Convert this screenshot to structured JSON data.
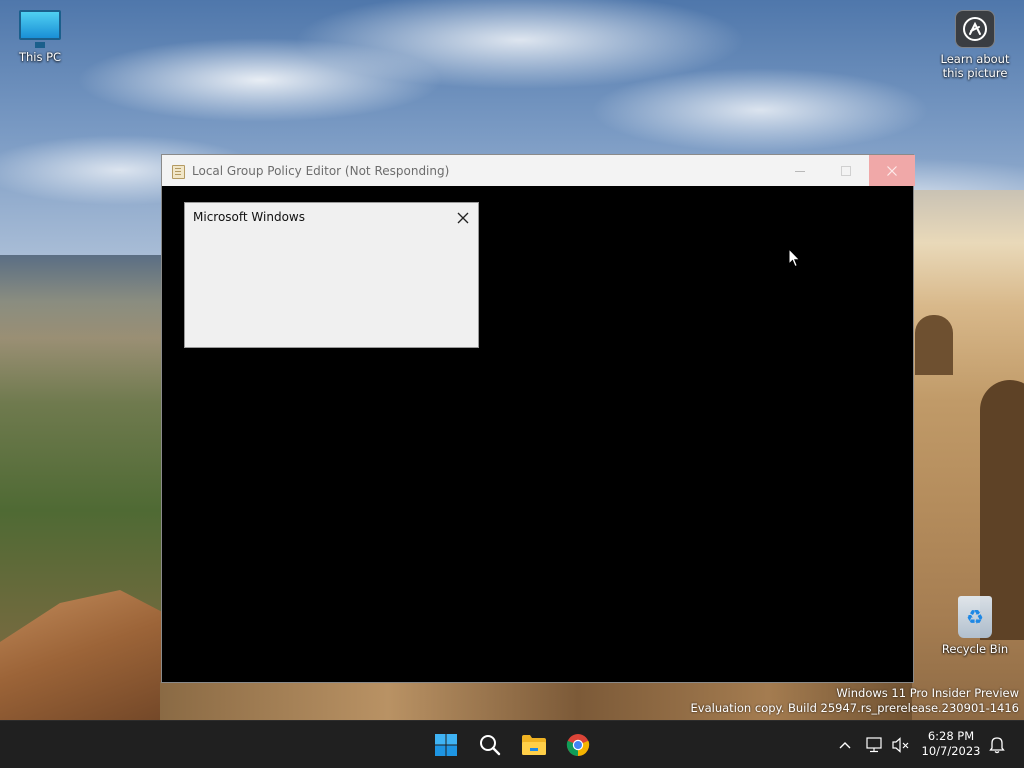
{
  "desktop": {
    "icons": {
      "this_pc": "This PC",
      "learn_line1": "Learn about",
      "learn_line2": "this picture",
      "recycle_bin": "Recycle Bin"
    }
  },
  "window": {
    "title": "Local Group Policy Editor (Not Responding)",
    "buttons": [
      "minimize-icon",
      "maximize-icon",
      "close-icon"
    ]
  },
  "dialog": {
    "title": "Microsoft Windows",
    "close_icon": "close-icon"
  },
  "watermark": {
    "line1": "Windows 11 Pro Insider Preview",
    "line2": "Evaluation copy. Build 25947.rs_prerelease.230901-1416"
  },
  "taskbar": {
    "pinned": [
      "windows-start-icon",
      "search-icon",
      "file-explorer-icon",
      "chrome-icon"
    ],
    "tray": [
      "chevron-up-icon",
      "network-icon",
      "volume-muted-icon",
      "notification-bell-icon"
    ],
    "clock": {
      "time": "6:28 PM",
      "date": "10/7/2023"
    }
  },
  "colors": {
    "taskbar_bg": "#202020",
    "close_hover": "#f0a8a8",
    "dialog_bg": "#f0f0f0",
    "window_client": "#000000"
  }
}
